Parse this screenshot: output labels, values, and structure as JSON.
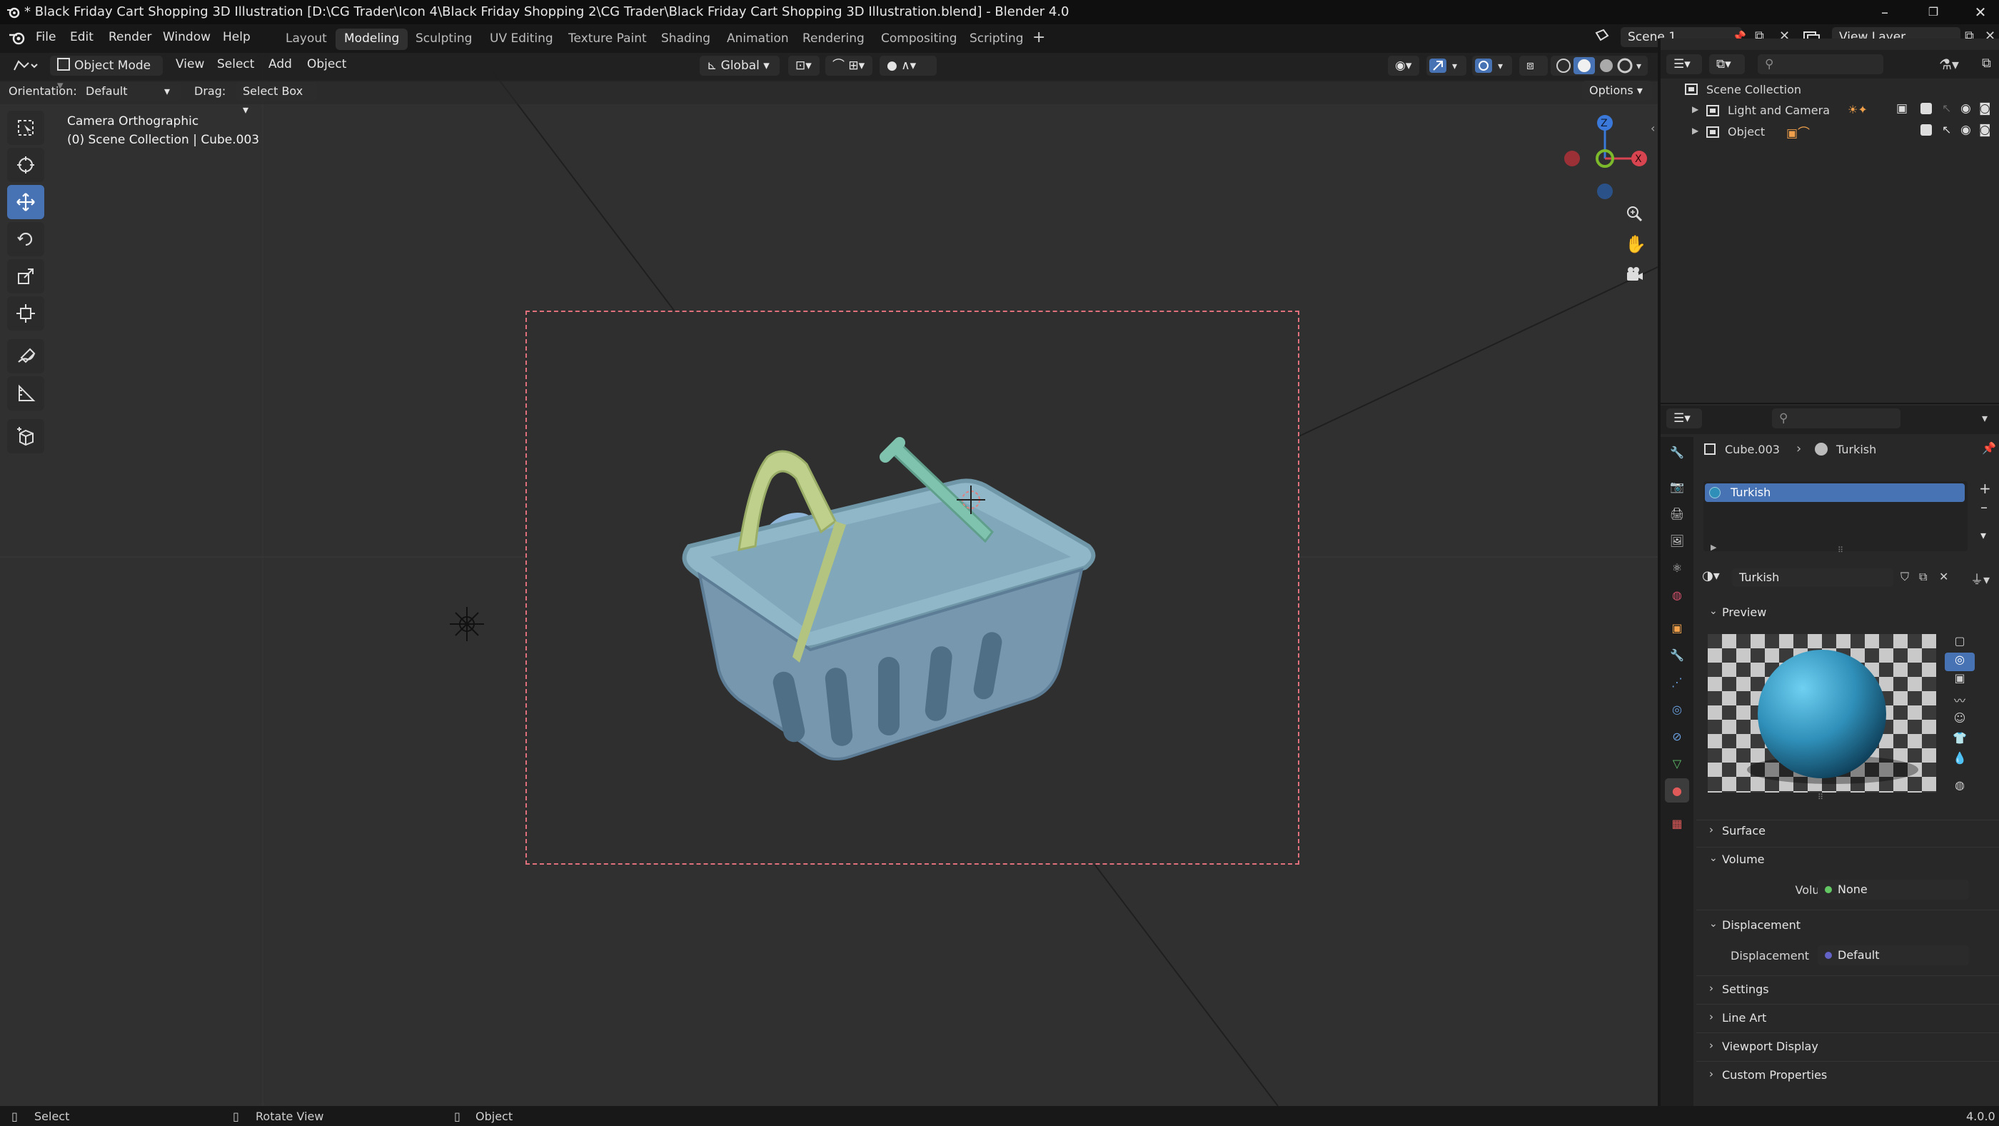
{
  "window": {
    "title": "* Black Friday Cart Shopping 3D Illustration [D:\\CG Trader\\Icon 4\\Black Friday Shopping 2\\CG Trader\\Black Friday Cart Shopping 3D Illustration.blend] - Blender 4.0"
  },
  "menu": [
    "File",
    "Edit",
    "Render",
    "Window",
    "Help"
  ],
  "workspaces": [
    "Layout",
    "Modeling",
    "Sculpting",
    "UV Editing",
    "Texture Paint",
    "Shading",
    "Animation",
    "Rendering",
    "Compositing",
    "Scripting"
  ],
  "active_workspace": "Modeling",
  "scene": "Scene 1",
  "view_layer": "View Layer",
  "viewport_header": {
    "mode": "Object Mode",
    "menus": [
      "View",
      "Select",
      "Add",
      "Object"
    ],
    "transform_orientation": "Global",
    "options": "Options"
  },
  "tool_settings": {
    "orientation_label": "Orientation:",
    "orientation_value": "Default",
    "drag_label": "Drag:",
    "drag_value": "Select Box"
  },
  "viewport_overlay": {
    "camera": "Camera Orthographic",
    "collection": "(0) Scene Collection | Cube.003"
  },
  "gizmo_axes": {
    "x": "X",
    "y": "Y",
    "z": "Z"
  },
  "outliner": {
    "root": "Scene Collection",
    "items": [
      {
        "label": "Light and Camera"
      },
      {
        "label": "Object"
      }
    ]
  },
  "properties": {
    "breadcrumb_object": "Cube.003",
    "breadcrumb_material": "Turkish",
    "slot_name": "Turkish",
    "material_name": "Turkish",
    "sections": {
      "preview": "Preview",
      "surface": "Surface",
      "volume": "Volume",
      "displacement": "Displacement",
      "settings": "Settings",
      "line_art": "Line Art",
      "viewport_display": "Viewport Display",
      "custom_properties": "Custom Properties"
    },
    "volume_label": "Volume",
    "volume_value": "None",
    "displacement_label": "Displacement",
    "displacement_value": "Default"
  },
  "statusbar": {
    "left": "Select",
    "middle": "Rotate View",
    "right": "Object",
    "version": "4.0.0"
  },
  "colors": {
    "accent_blue": "#4772b3",
    "camera_frame": "#e0707c",
    "material_sphere": "#2f8fb8"
  }
}
